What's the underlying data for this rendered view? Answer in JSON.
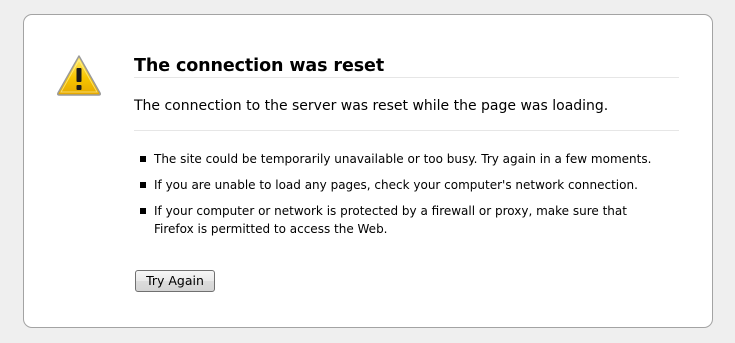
{
  "error_page": {
    "icon": "warning-icon",
    "title": "The connection was reset",
    "short_description": "The connection to the server was reset while the page was loading.",
    "suggestions": [
      "The site could be temporarily unavailable or too busy. Try again in a few moments.",
      "If you are unable to load any pages, check your computer's network connection.",
      "If your computer or network is protected by a firewall or proxy, make sure that Firefox is permitted to access the Web."
    ],
    "try_again_label": "Try Again"
  },
  "colors": {
    "page_background": "#efefef",
    "box_background": "#ffffff",
    "box_border": "#a3a3a3",
    "warning_yellow": "#f5c400"
  }
}
